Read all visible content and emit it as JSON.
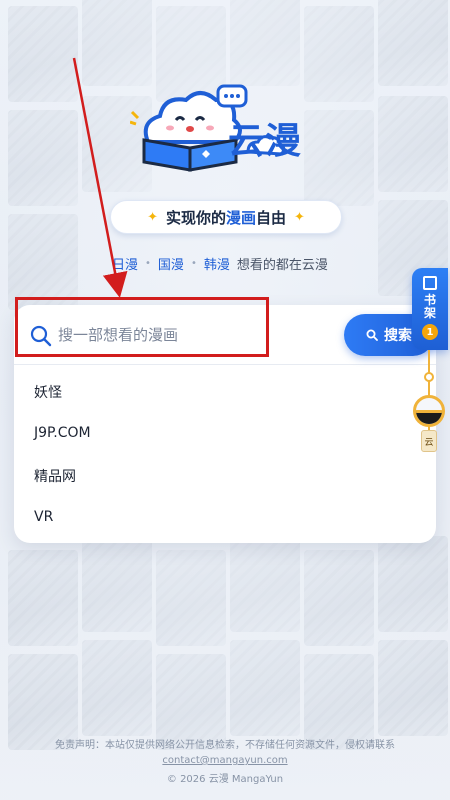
{
  "brand": {
    "logo_text": "云漫",
    "slogan_prefix": "实现你的",
    "slogan_highlight": "漫画",
    "slogan_suffix": "自由"
  },
  "tags": {
    "items": [
      "日漫",
      "国漫",
      "韩漫"
    ],
    "desc": "想看的都在云漫"
  },
  "search": {
    "placeholder": "搜一部想看的漫画",
    "value": "",
    "button_label": "搜索"
  },
  "suggestions": [
    "妖怪",
    "J9P.COM",
    "精品网",
    "VR"
  ],
  "bookshelf": {
    "label_line1": "书",
    "label_line2": "架",
    "badge_count": "1",
    "rail_tag": "云"
  },
  "footer": {
    "disclaimer": "免责声明：本站仅提供网络公开信息检索，不存储任何资源文件，侵权请联系",
    "contact": "contact@mangayun.com",
    "copyright": "© 2026 云漫 MangaYun"
  },
  "colors": {
    "accent": "#1f5fd6",
    "annotation": "#d21d1d",
    "badge": "#f5a60c"
  }
}
